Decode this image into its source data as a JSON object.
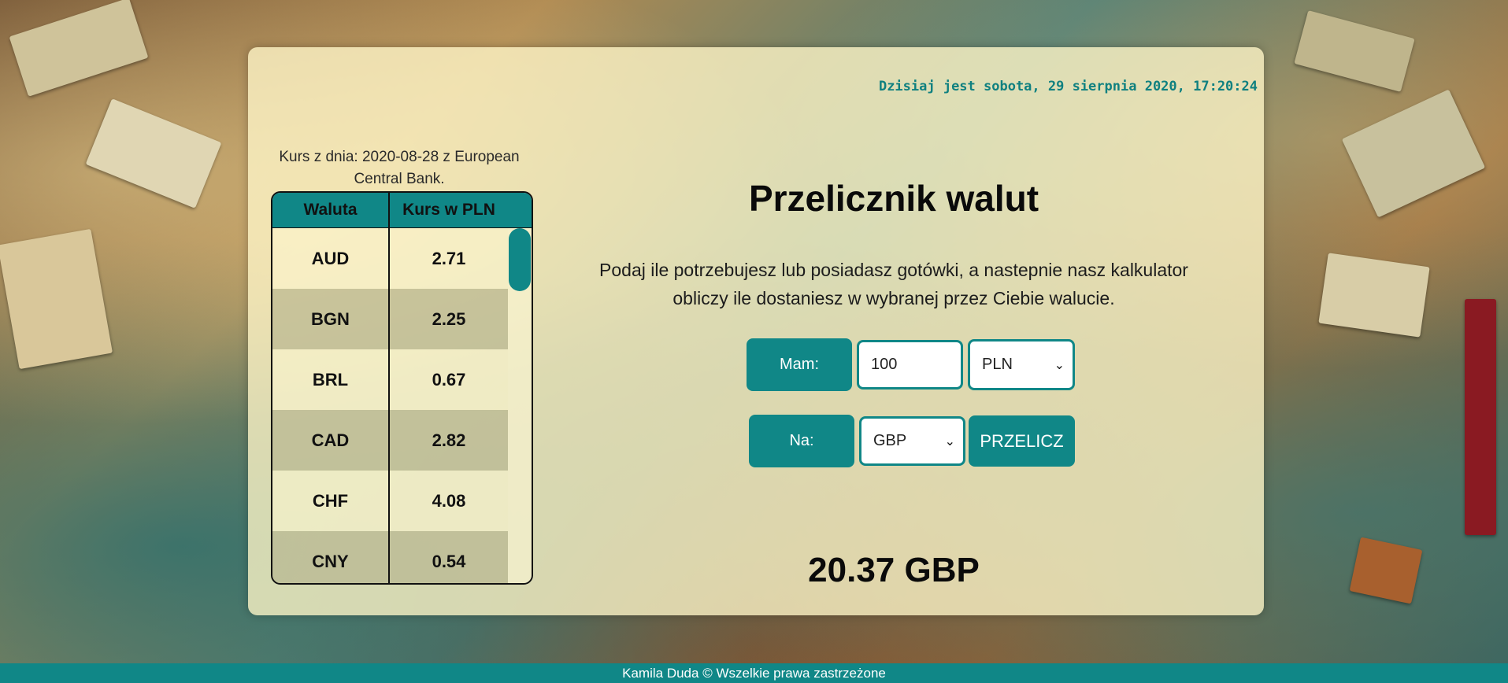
{
  "clock": "Dzisiaj jest sobota, 29 sierpnia 2020, 17:20:24",
  "rates": {
    "caption": "Kurs z dnia: 2020-08-28 z European Central Bank.",
    "headers": [
      "Waluta",
      "Kurs w PLN"
    ],
    "rows": [
      {
        "code": "AUD",
        "rate": "2.71"
      },
      {
        "code": "BGN",
        "rate": "2.25"
      },
      {
        "code": "BRL",
        "rate": "0.67"
      },
      {
        "code": "CAD",
        "rate": "2.82"
      },
      {
        "code": "CHF",
        "rate": "4.08"
      },
      {
        "code": "CNY",
        "rate": "0.54"
      }
    ]
  },
  "converter": {
    "title": "Przelicznik walut",
    "description": "Podaj ile potrzebujesz lub posiadasz gotówki, a nastepnie nasz kalkulator obliczy ile dostaniesz w wybranej przez Ciebie walucie.",
    "have_label": "Mam:",
    "amount_value": "100",
    "from_currency": "PLN",
    "to_label": "Na:",
    "to_currency": "GBP",
    "convert_button": "PRZELICZ",
    "result": "20.37 GBP"
  },
  "footer": "Kamila Duda © Wszelkie prawa zastrzeżone",
  "colors": {
    "accent": "#108787",
    "panel": "#fff6c8"
  }
}
